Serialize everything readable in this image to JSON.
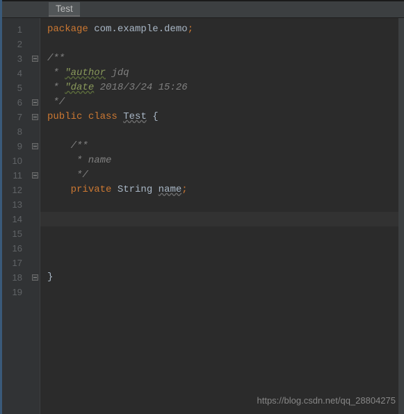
{
  "tab": {
    "label": "Test"
  },
  "gutter": {
    "lines": [
      "1",
      "2",
      "3",
      "4",
      "5",
      "6",
      "7",
      "8",
      "9",
      "10",
      "11",
      "12",
      "13",
      "14",
      "15",
      "16",
      "17",
      "18",
      "19"
    ]
  },
  "fold": {
    "marks": [
      "",
      "",
      "open",
      "",
      "",
      "close",
      "open",
      "",
      "open",
      "",
      "close",
      "",
      "",
      "",
      "",
      "",
      "",
      "close",
      ""
    ]
  },
  "code": {
    "l1": {
      "kw": "package",
      "pkg": " com.example.demo",
      "semi": ";"
    },
    "l3": {
      "text": "/**"
    },
    "l4": {
      "pre": " * ",
      "tag": "\"author",
      "val": " jdq"
    },
    "l5": {
      "pre": " * ",
      "tag": "\"date",
      "val": " 2018/3/24 15:26"
    },
    "l6": {
      "text": " */"
    },
    "l7": {
      "kw1": "public",
      "kw2": "class",
      "name": "Test",
      "brace": " {"
    },
    "l9": {
      "text": "    /**"
    },
    "l10": {
      "text": "     * name"
    },
    "l11": {
      "text": "     */"
    },
    "l12": {
      "kw": "private",
      "type": " String ",
      "name": "name",
      "semi": ";"
    },
    "l18": {
      "brace": "}"
    }
  },
  "editor": {
    "currentLine": 14
  },
  "watermark": {
    "text": "https://blog.csdn.net/qq_28804275"
  }
}
